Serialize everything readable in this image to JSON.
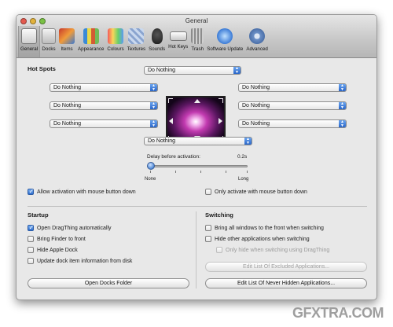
{
  "window": {
    "title": "General"
  },
  "toolbar": {
    "items": [
      {
        "label": "General",
        "icon": "general-icon",
        "selected": true
      },
      {
        "label": "Docks",
        "icon": "docks-icon"
      },
      {
        "label": "Items",
        "icon": "items-icon"
      },
      {
        "label": "Appearance",
        "icon": "appearance-icon"
      },
      {
        "label": "Colours",
        "icon": "colours-icon"
      },
      {
        "label": "Textures",
        "icon": "textures-icon"
      },
      {
        "label": "Sounds",
        "icon": "sounds-icon"
      },
      {
        "label": "Hot Keys",
        "icon": "hot-keys-icon"
      },
      {
        "label": "Trash",
        "icon": "trash-icon"
      },
      {
        "label": "Software Update",
        "icon": "software-update-icon"
      },
      {
        "label": "Advanced",
        "icon": "advanced-icon"
      }
    ]
  },
  "hot_spots": {
    "title": "Hot Spots",
    "top": "Do Nothing",
    "left_top": "Do Nothing",
    "left_middle": "Do Nothing",
    "left_bottom": "Do Nothing",
    "right_top": "Do Nothing",
    "right_middle": "Do Nothing",
    "right_bottom": "Do Nothing",
    "bottom": "Do Nothing",
    "delay_label": "Delay before activation:",
    "delay_value": "0.2s",
    "slider_min_label": "None",
    "slider_max_label": "Long",
    "allow_mouse_down": {
      "label": "Allow activation with mouse button down",
      "checked": true
    },
    "only_mouse_down": {
      "label": "Only activate with mouse button down",
      "checked": false
    }
  },
  "startup": {
    "title": "Startup",
    "options": [
      {
        "label": "Open DragThing automatically",
        "checked": true
      },
      {
        "label": "Bring Finder to front",
        "checked": false
      },
      {
        "label": "Hide Apple Dock",
        "checked": false
      },
      {
        "label": "Update dock item information from disk",
        "checked": false
      }
    ],
    "open_docks_button": "Open Docks Folder"
  },
  "switching": {
    "title": "Switching",
    "options": [
      {
        "label": "Bring all windows to the front when switching",
        "checked": false
      },
      {
        "label": "Hide other applications when switching",
        "checked": false
      },
      {
        "label": "Only hide when switching using DragThing",
        "checked": false,
        "disabled": true
      }
    ],
    "excluded_button": "Edit List Of Excluded Applications...",
    "never_hidden_button": "Edit List Of Never Hidden Applications..."
  },
  "watermark": {
    "text": "GFXTRA.COM"
  }
}
